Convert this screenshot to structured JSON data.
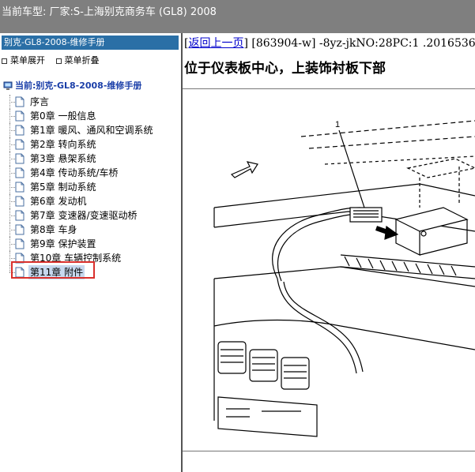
{
  "topbar": {
    "text": "当前车型:  厂家:S-上海别克商务车 (GL8) 2008"
  },
  "left": {
    "title": "别克-GL8-2008-维修手册",
    "expand_label": "菜单展开",
    "collapse_label": "菜单折叠",
    "current_label": "当前:别克-GL8-2008-维修手册",
    "items": [
      {
        "label": "序言"
      },
      {
        "label": "第0章 一般信息"
      },
      {
        "label": "第1章 暖风、通风和空调系统"
      },
      {
        "label": "第2章 转向系统"
      },
      {
        "label": "第3章 悬架系统"
      },
      {
        "label": "第4章 传动系统/车桥"
      },
      {
        "label": "第5章 制动系统"
      },
      {
        "label": "第6章 发动机"
      },
      {
        "label": "第7章 变速器/变速驱动桥"
      },
      {
        "label": "第8章 车身"
      },
      {
        "label": "第9章 保护装置"
      },
      {
        "label": "第10章 车辆控制系统"
      },
      {
        "label": "第11章 附件"
      }
    ],
    "selected_index": 12
  },
  "right": {
    "back_link": "返回上一页",
    "doc_code": "[863904-w] -8yz-jkNO:28PC:1 .2016536",
    "heading": "位于仪表板中心，上装饰衬板下部",
    "figure_callout": "1"
  },
  "colors": {
    "topbar_bg": "#7f7f7f",
    "header_blue": "#2a6fa6",
    "highlight_red": "#d9302c",
    "link_blue": "#0000cc"
  }
}
